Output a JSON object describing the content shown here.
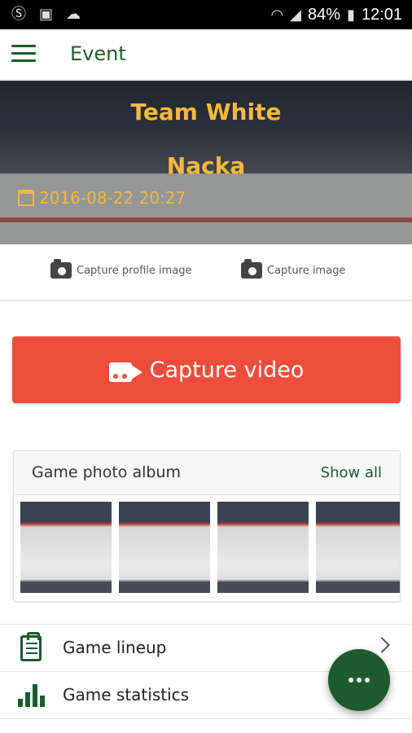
{
  "status_bar": {
    "battery": "84%",
    "time": "12:01",
    "icons": [
      "skype-icon",
      "gallery-icon",
      "cloud-icon",
      "wifi-icon",
      "signal-icon",
      "battery-icon"
    ]
  },
  "app_bar": {
    "title": "Event",
    "menu_icon": "hamburger-menu-icon"
  },
  "event": {
    "team": "Team White",
    "opponent": "Nacka",
    "datetime": "2016-08-22 20:27",
    "accent_color": "#f3b940"
  },
  "capture_options": {
    "profile_image_label": "Capture profile image",
    "image_label": "Capture image"
  },
  "video_button": {
    "label": "Capture video",
    "color": "#ef4d3b"
  },
  "album": {
    "title": "Game photo album",
    "show_all": "Show all",
    "photo_count_visible": 4
  },
  "menu_list": [
    {
      "label": "Game lineup",
      "icon": "clipboard-icon"
    },
    {
      "label": "Game statistics",
      "icon": "bar-chart-icon"
    }
  ],
  "fab": {
    "icon": "more-dots-icon",
    "color": "#1d5b2f"
  },
  "brand_color": "#1d5b2f"
}
